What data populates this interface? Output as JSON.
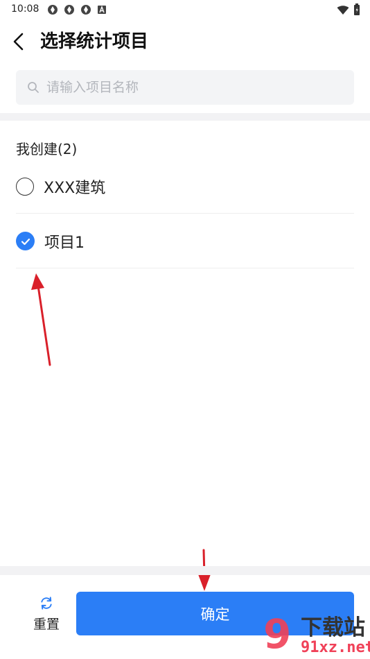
{
  "status_bar": {
    "time": "10:08"
  },
  "header": {
    "title": "选择统计项目"
  },
  "search": {
    "placeholder": "请输入项目名称",
    "value": ""
  },
  "group": {
    "title": "我创建(2)"
  },
  "options": [
    {
      "label": "XXX建筑",
      "checked": false
    },
    {
      "label": "项目1",
      "checked": true
    }
  ],
  "footer": {
    "reset_label": "重置",
    "confirm_label": "确定"
  },
  "watermark": {
    "big": "9",
    "top": "下载站",
    "bottom": "91xz.net"
  },
  "colors": {
    "accent": "#2b7ef6",
    "arrow": "#d9202a",
    "divider": "#f2f2f4"
  }
}
